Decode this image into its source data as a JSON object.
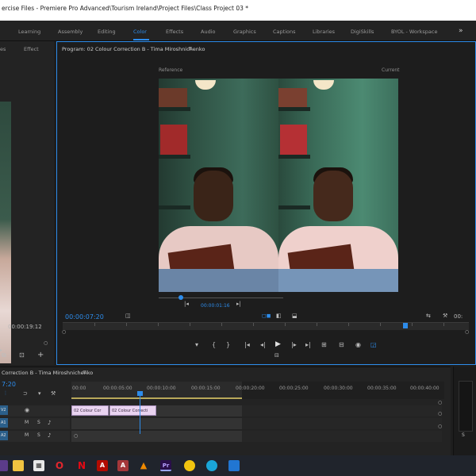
{
  "window": {
    "title": "ercise Files - Premiere Pro Advanced\\Tourism Ireland\\Project Files\\Class Project 03 *"
  },
  "workspaces": {
    "tabs": [
      "Learning",
      "Assembly",
      "Editing",
      "Color",
      "Effects",
      "Audio",
      "Graphics",
      "Captions",
      "Libraries",
      "DigiSkills",
      "BYOL - Workspace"
    ],
    "active": "Color",
    "more": "»"
  },
  "source_panel": {
    "tab_a": "es",
    "tab_b": "Effect",
    "timecode": "00:00:19:12"
  },
  "program": {
    "title": "Program: 02 Colour Correction B - Tima Miroshnichenko",
    "menu_icon": "≡",
    "reference_label": "Reference",
    "current_label": "Current",
    "reference_timecode": "00:00:01:16",
    "playhead_timecode": "00:00:07:20",
    "accent": "#2d8ceb"
  },
  "timeline": {
    "title": "Correction B - Tima Miroshnichenko",
    "menu_icon": "≡",
    "timecode": "7:20",
    "ruler_marks": [
      "00:00",
      "00:00:05:00",
      "00:00:10:00",
      "00:00:15:00",
      "00:00:20:00",
      "00:00:25:00",
      "00:00:30:00",
      "00:00:35:00",
      "00:00:40:00"
    ],
    "clips": [
      "02 Colour Cor",
      "02 Colour Correcti"
    ],
    "tracks": [
      "V2",
      "A1",
      "A2"
    ],
    "track_icons": [
      "M",
      "S"
    ]
  },
  "meter": {
    "label": "S"
  },
  "taskbar": {
    "apps": [
      "start",
      "files",
      "calendar",
      "opera",
      "netflix",
      "acrobat",
      "access",
      "vlc",
      "premiere",
      "chrome",
      "edge",
      "store"
    ]
  }
}
